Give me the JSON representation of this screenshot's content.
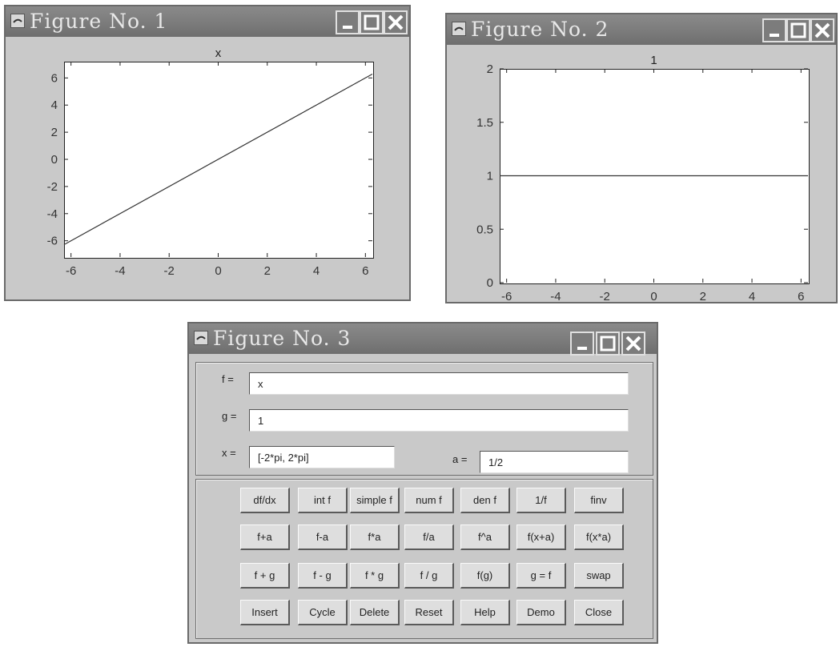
{
  "windows": [
    {
      "title": "Figure No. 1",
      "chart_data": {
        "type": "line",
        "title": "x",
        "x": [
          -6.2832,
          6.2832
        ],
        "y": [
          -6.2832,
          6.2832
        ],
        "xlim": [
          -6.2832,
          6.2832
        ],
        "ylim": [
          -7.2,
          7.2
        ],
        "xticks": [
          -6,
          -4,
          -2,
          0,
          2,
          4,
          6
        ],
        "yticks": [
          -6,
          -4,
          -2,
          0,
          2,
          4,
          6
        ],
        "grid": false
      }
    },
    {
      "title": "Figure No. 2",
      "chart_data": {
        "type": "line",
        "title": "1",
        "x": [
          -6.2832,
          6.2832
        ],
        "y": [
          1,
          1
        ],
        "xlim": [
          -6.2832,
          6.2832
        ],
        "ylim": [
          0,
          2
        ],
        "xticks": [
          -6,
          -4,
          -2,
          0,
          2,
          4,
          6
        ],
        "yticks": [
          0,
          0.5,
          1,
          1.5,
          2
        ],
        "grid": false
      }
    },
    {
      "title": "Figure No. 3"
    }
  ],
  "calculator": {
    "f_label": "f =",
    "f_value": "x",
    "g_label": "g =",
    "g_value": "1",
    "x_label": "x =",
    "x_value": "[-2*pi, 2*pi]",
    "a_label": "a =",
    "a_value": "1/2",
    "buttons": [
      [
        "df/dx",
        "int f",
        "simple f",
        "num f",
        "den f",
        "1/f",
        "finv"
      ],
      [
        "f+a",
        "f-a",
        "f*a",
        "f/a",
        "f^a",
        "f(x+a)",
        "f(x*a)"
      ],
      [
        "f + g",
        "f - g",
        "f * g",
        "f / g",
        "f(g)",
        "g = f",
        "swap"
      ],
      [
        "Insert",
        "Cycle",
        "Delete",
        "Reset",
        "Help",
        "Demo",
        "Close"
      ]
    ]
  },
  "icons": {
    "title_icon": "matlab-figure-icon",
    "minimize": "minimize-icon",
    "maximize": "maximize-icon",
    "close": "close-icon"
  }
}
